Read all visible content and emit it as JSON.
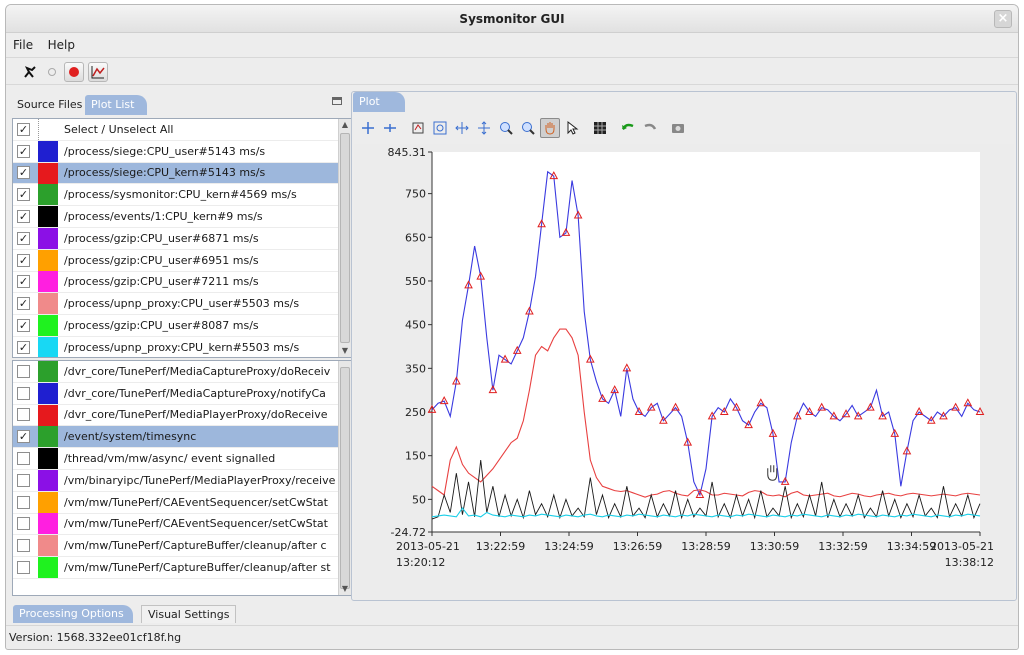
{
  "window": {
    "title": "Sysmonitor GUI",
    "close_symbol": "×"
  },
  "menu": {
    "items": [
      "File",
      "Help"
    ]
  },
  "left_panel": {
    "tabs": {
      "source_files": "Source Files",
      "plot_list": "Plot List"
    },
    "selected_items": [
      {
        "label": "Select / Unselect All",
        "checked": "✓",
        "color": "",
        "selected": false
      },
      {
        "label": "/process/siege:CPU_user#5143 ms/s",
        "checked": "✓",
        "color": "#1f1fd0",
        "selected": false
      },
      {
        "label": "/process/siege:CPU_kern#5143 ms/s",
        "checked": "✓",
        "color": "#e6191d",
        "selected": true
      },
      {
        "label": "/process/sysmonitor:CPU_kern#4569 ms/s",
        "checked": "✓",
        "color": "#2ca02c",
        "selected": false
      },
      {
        "label": "/process/events/1:CPU_kern#9 ms/s",
        "checked": "✓",
        "color": "#000000",
        "selected": false
      },
      {
        "label": "/process/gzip:CPU_user#6871 ms/s",
        "checked": "✓",
        "color": "#8b10e6",
        "selected": false
      },
      {
        "label": "/process/gzip:CPU_user#6951 ms/s",
        "checked": "✓",
        "color": "#ffa000",
        "selected": false
      },
      {
        "label": "/process/gzip:CPU_user#7211 ms/s",
        "checked": "✓",
        "color": "#ff1fe0",
        "selected": false
      },
      {
        "label": "/process/upnp_proxy:CPU_user#5503 ms/s",
        "checked": "✓",
        "color": "#f08a8a",
        "selected": false
      },
      {
        "label": "/process/gzip:CPU_user#8087 ms/s",
        "checked": "✓",
        "color": "#1ff21f",
        "selected": false
      },
      {
        "label": "/process/upnp_proxy:CPU_kern#5503 ms/s",
        "checked": "✓",
        "color": "#18d8f4",
        "selected": false
      }
    ],
    "all_items": [
      {
        "label": "/dvr_core/TunePerf/MediaCaptureProxy/doReceiv",
        "checked": "",
        "color": "#2ca02c",
        "selected": false
      },
      {
        "label": "/dvr_core/TunePerf/MediaCaptureProxy/notifyCa",
        "checked": "",
        "color": "#1f1fd0",
        "selected": false
      },
      {
        "label": "/dvr_core/TunePerf/MediaPlayerProxy/doReceive",
        "checked": "",
        "color": "#e6191d",
        "selected": false
      },
      {
        "label": "/event/system/timesync",
        "checked": "✓",
        "color": "#2ca02c",
        "selected": true
      },
      {
        "label": "/thread/vm/mw/async/ event signalled",
        "checked": "",
        "color": "#000000",
        "selected": false
      },
      {
        "label": "/vm/binaryipc/TunePerf/MediaPlayerProxy/receive",
        "checked": "",
        "color": "#8b10e6",
        "selected": false
      },
      {
        "label": "/vm/mw/TunePerf/CAEventSequencer/setCwStat",
        "checked": "",
        "color": "#ffa000",
        "selected": false
      },
      {
        "label": "/vm/mw/TunePerf/CAEventSequencer/setCwStat",
        "checked": "",
        "color": "#ff1fe0",
        "selected": false
      },
      {
        "label": "/vm/mw/TunePerf/CaptureBuffer/cleanup/after c",
        "checked": "",
        "color": "#f08a8a",
        "selected": false
      },
      {
        "label": "/vm/mw/TunePerf/CaptureBuffer/cleanup/after st",
        "checked": "",
        "color": "#1ff21f",
        "selected": false
      }
    ]
  },
  "bottom_tabs": {
    "processing_options": "Processing Options",
    "visual_settings": "Visual Settings"
  },
  "status": {
    "version": "Version: 1568.332ee01cf18f.hg"
  },
  "plot_panel": {
    "tab_label": "Plot"
  },
  "chart_data": {
    "type": "line",
    "y_ticks": [
      "845.31",
      "750",
      "650",
      "550",
      "450",
      "350",
      "250",
      "150",
      "50",
      "-24.72"
    ],
    "ylim": [
      -24.72,
      845.31
    ],
    "x_ticks": [
      [
        "2013-05-21",
        "13:20:12"
      ],
      [
        "13:22:59"
      ],
      [
        "13:24:59"
      ],
      [
        "13:26:59"
      ],
      [
        "13:28:59"
      ],
      [
        "13:30:59"
      ],
      [
        "13:32:59"
      ],
      [
        "13:34:59"
      ],
      [
        "2013-05-21",
        "13:38:12"
      ]
    ],
    "x": [
      0,
      0.2,
      0.4,
      0.6,
      0.8,
      1,
      1.2,
      1.4,
      1.6,
      1.8,
      2,
      2.2,
      2.4,
      2.6,
      2.8,
      3,
      3.2,
      3.4,
      3.6,
      3.8,
      4,
      4.2,
      4.4,
      4.6,
      4.8,
      5,
      5.2,
      5.4,
      5.6,
      5.8,
      6,
      6.2,
      6.4,
      6.6,
      6.8,
      7,
      7.2,
      7.4,
      7.6,
      7.8,
      8,
      8.2,
      8.4,
      8.6,
      8.8,
      9,
      9.2,
      9.4,
      9.6,
      9.8,
      10,
      10.2,
      10.4,
      10.6,
      10.8,
      11,
      11.2,
      11.4,
      11.6,
      11.8,
      12,
      12.2,
      12.4,
      12.6,
      12.8,
      13,
      13.2,
      13.4,
      13.6,
      13.8,
      14,
      14.2,
      14.4,
      14.6,
      14.8,
      15,
      15.2,
      15.4,
      15.6,
      15.8,
      16,
      16.2,
      16.4,
      16.6,
      16.8,
      17,
      17.2,
      17.4,
      17.6,
      17.8,
      18
    ],
    "series": [
      {
        "color": "#3a3ae0",
        "values": [
          255,
          270,
          275,
          240,
          320,
          460,
          540,
          630,
          560,
          420,
          300,
          380,
          370,
          360,
          390,
          420,
          480,
          560,
          680,
          800,
          790,
          650,
          660,
          780,
          700,
          480,
          370,
          320,
          280,
          270,
          300,
          240,
          350,
          280,
          250,
          240,
          260,
          270,
          230,
          245,
          260,
          240,
          180,
          90,
          60,
          120,
          240,
          260,
          250,
          280,
          260,
          230,
          220,
          250,
          270,
          260,
          200,
          90,
          90,
          180,
          240,
          270,
          250,
          240,
          260,
          255,
          240,
          230,
          245,
          265,
          240,
          250,
          260,
          300,
          240,
          250,
          200,
          80,
          160,
          230,
          250,
          240,
          230,
          250,
          240,
          255,
          260,
          240,
          270,
          255,
          250
        ]
      },
      {
        "color": "#e84040",
        "values": [
          80,
          70,
          60,
          140,
          170,
          130,
          110,
          100,
          90,
          105,
          120,
          140,
          160,
          180,
          190,
          230,
          300,
          380,
          400,
          390,
          420,
          440,
          440,
          420,
          380,
          250,
          140,
          100,
          80,
          75,
          70,
          68,
          70,
          65,
          60,
          55,
          60,
          62,
          68,
          70,
          64,
          60,
          58,
          70,
          72,
          68,
          60,
          60,
          64,
          62,
          60,
          58,
          66,
          70,
          68,
          60,
          58,
          60,
          56,
          64,
          68,
          60,
          58,
          60,
          62,
          64,
          58,
          56,
          60,
          64,
          62,
          58,
          56,
          60,
          62,
          64,
          60,
          58,
          62,
          64,
          62,
          60,
          58,
          60,
          62,
          60,
          58,
          62,
          64,
          62,
          60
        ]
      },
      {
        "color": "#1a1a1a",
        "values": [
          5,
          10,
          60,
          20,
          110,
          15,
          90,
          10,
          140,
          20,
          80,
          10,
          60,
          12,
          50,
          8,
          70,
          15,
          40,
          10,
          60,
          8,
          50,
          12,
          30,
          10,
          100,
          15,
          60,
          8,
          40,
          10,
          80,
          12,
          30,
          8,
          60,
          10,
          40,
          12,
          70,
          8,
          50,
          10,
          30,
          12,
          90,
          10,
          40,
          8,
          60,
          12,
          50,
          8,
          70,
          10,
          30,
          12,
          80,
          8,
          40,
          10,
          60,
          12,
          90,
          8,
          50,
          10,
          40,
          12,
          60,
          8,
          30,
          10,
          70,
          12,
          50,
          8,
          40,
          10,
          60,
          12,
          30,
          8,
          80,
          10,
          40,
          12,
          60,
          8,
          40
        ]
      },
      {
        "color": "#1ccfe8",
        "values": [
          10,
          12,
          14,
          12,
          10,
          30,
          12,
          14,
          10,
          20,
          14,
          12,
          10,
          14,
          12,
          10,
          14,
          12,
          16,
          14,
          12,
          10,
          14,
          12,
          10,
          14,
          16,
          12,
          10,
          14,
          12,
          10,
          14,
          12,
          16,
          14,
          12,
          10,
          14,
          12,
          10,
          14,
          12,
          16,
          14,
          12,
          10,
          14,
          12,
          10,
          14,
          12,
          16,
          14,
          12,
          10,
          14,
          12,
          10,
          14,
          12,
          16,
          14,
          12,
          10,
          14,
          12,
          10,
          14,
          12,
          16,
          14,
          12,
          10,
          14,
          12,
          10,
          14,
          12,
          16,
          14,
          12,
          10,
          14,
          12,
          10,
          14,
          12,
          16,
          14,
          12
        ]
      }
    ],
    "grid": false
  }
}
